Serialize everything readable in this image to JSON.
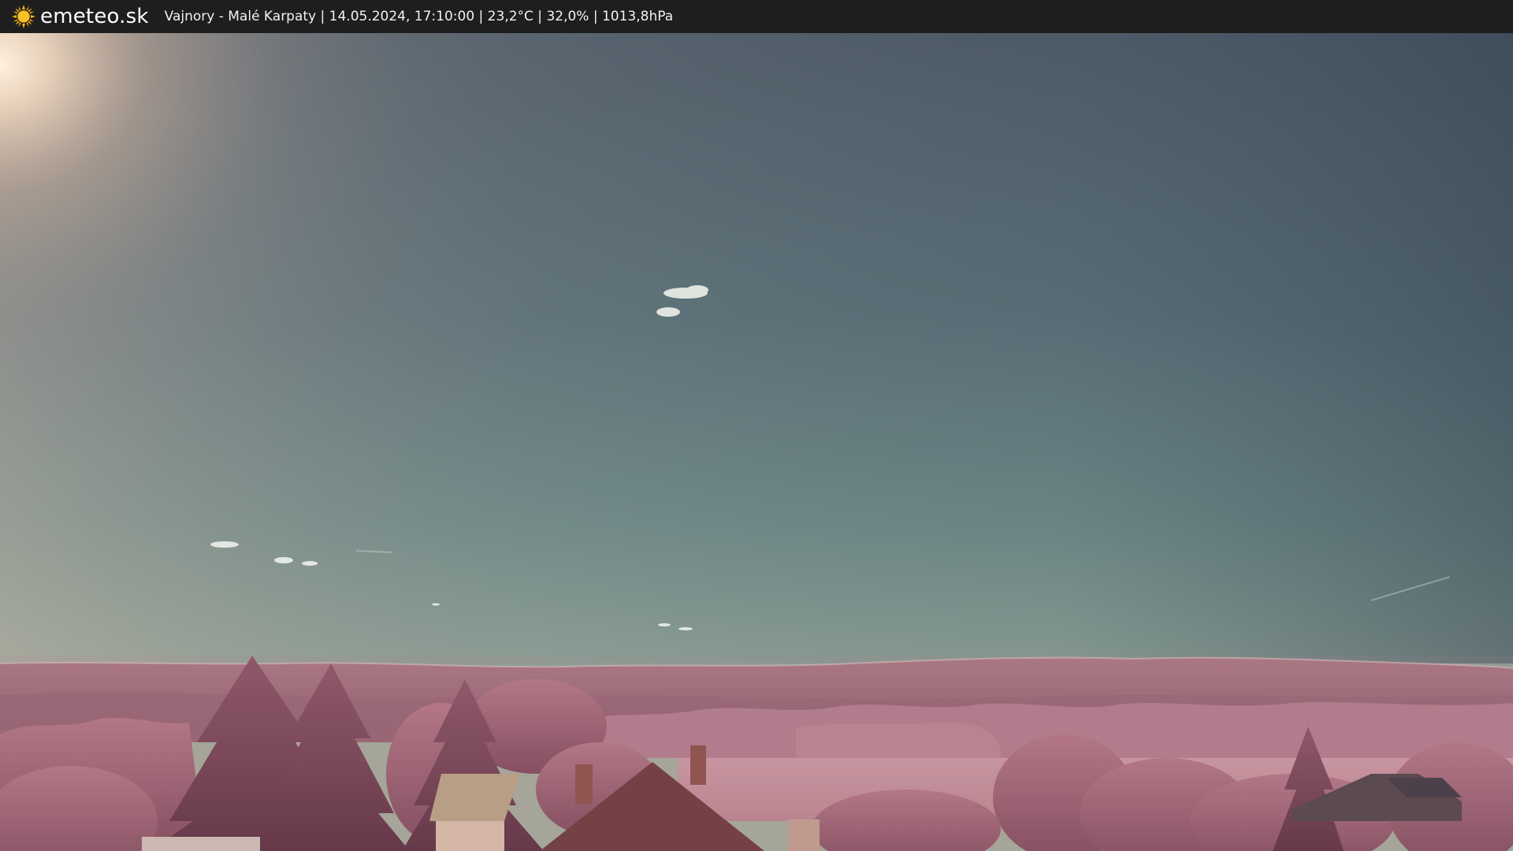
{
  "header": {
    "brand": "emeteo.sk",
    "caption": "Vajnory - Malé Karpaty | 14.05.2024, 17:10:00 | 23,2°C | 32,0% | 1013,8hPa"
  },
  "icons": {
    "logo": "sun-icon"
  },
  "colors": {
    "bar_background": "#1e1e1e",
    "sun": "#f5b21b"
  }
}
